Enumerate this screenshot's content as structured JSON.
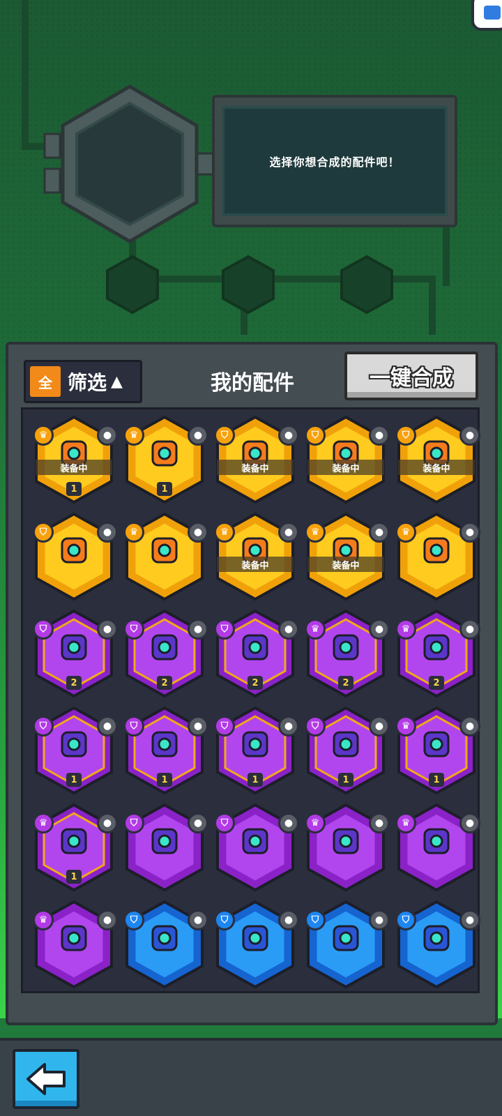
{
  "header": {
    "message": "选择你想合成的配件吧！"
  },
  "panel": {
    "filter_badge": "全",
    "filter_label": "筛选",
    "filter_arrow": "▲",
    "title": "我的配件",
    "merge_button": "一键合成"
  },
  "colors": {
    "gold": "#f7b90c",
    "purple": "#a537e0",
    "blue": "#1d86f0",
    "panel": "#444d52",
    "back_button": "#30b6ec"
  },
  "parts": [
    {
      "tier": "gold",
      "rank": "crown",
      "slot_icon": "device-icon",
      "equipped": "装备中",
      "count": "1",
      "part_icon": "orange-turret-icon"
    },
    {
      "tier": "gold",
      "rank": "crown",
      "slot_icon": "bird-icon",
      "equipped": "",
      "count": "1",
      "part_icon": "orange-drill-icon"
    },
    {
      "tier": "gold",
      "rank": "shield",
      "slot_icon": "rocket-icon",
      "equipped": "装备中",
      "count": "",
      "part_icon": "orange-wings-icon"
    },
    {
      "tier": "gold",
      "rank": "shield",
      "slot_icon": "plant-icon",
      "equipped": "装备中",
      "count": "",
      "part_icon": "orange-block-icon"
    },
    {
      "tier": "gold",
      "rank": "shield",
      "slot_icon": "radar-icon",
      "equipped": "装备中",
      "count": "",
      "part_icon": "orange-armor-icon"
    },
    {
      "tier": "gold",
      "rank": "shield",
      "slot_icon": "arc-icon",
      "equipped": "",
      "count": "",
      "part_icon": "orange-speaker-icon"
    },
    {
      "tier": "gold",
      "rank": "crown",
      "slot_icon": "drill-icon",
      "equipped": "",
      "count": "",
      "part_icon": "orange-cannon-icon"
    },
    {
      "tier": "gold",
      "rank": "crown",
      "slot_icon": "cone-icon",
      "equipped": "装备中",
      "count": "",
      "part_icon": "orange-robot-icon"
    },
    {
      "tier": "gold",
      "rank": "crown",
      "slot_icon": "soccer-icon",
      "equipped": "装备中",
      "count": "",
      "part_icon": "orange-core-icon"
    },
    {
      "tier": "gold",
      "rank": "crown",
      "slot_icon": "device-icon",
      "equipped": "",
      "count": "",
      "part_icon": "orange-gem-icon"
    },
    {
      "tier": "purple",
      "rank": "shield",
      "slot_icon": "rocket-icon",
      "equipped": "",
      "count": "2",
      "part_icon": "purple-wings-icon"
    },
    {
      "tier": "purple",
      "rank": "shield",
      "slot_icon": "brick-icon",
      "equipped": "",
      "count": "2",
      "part_icon": "purple-robot-icon"
    },
    {
      "tier": "purple",
      "rank": "shield",
      "slot_icon": "virus-icon",
      "equipped": "",
      "count": "2",
      "part_icon": "purple-pod-icon"
    },
    {
      "tier": "purple",
      "rank": "crown",
      "slot_icon": "cone-icon",
      "equipped": "",
      "count": "2",
      "part_icon": "purple-battery-icon"
    },
    {
      "tier": "purple",
      "rank": "crown",
      "slot_icon": "bottle-icon",
      "equipped": "",
      "count": "2",
      "part_icon": "purple-triangle-icon"
    },
    {
      "tier": "purple",
      "rank": "shield",
      "slot_icon": "rocket-icon",
      "equipped": "",
      "count": "1",
      "part_icon": "purple-wings-icon"
    },
    {
      "tier": "purple",
      "rank": "shield",
      "slot_icon": "radar-icon",
      "equipped": "",
      "count": "1",
      "part_icon": "purple-arm-icon"
    },
    {
      "tier": "purple",
      "rank": "shield",
      "slot_icon": "brick-icon",
      "equipped": "",
      "count": "1",
      "part_icon": "purple-robot-icon"
    },
    {
      "tier": "purple",
      "rank": "shield",
      "slot_icon": "arc-icon",
      "equipped": "",
      "count": "1",
      "part_icon": "purple-speaker-icon"
    },
    {
      "tier": "purple",
      "rank": "crown",
      "slot_icon": "soccer-icon",
      "equipped": "",
      "count": "1",
      "part_icon": "purple-core-icon"
    },
    {
      "tier": "purple",
      "rank": "crown",
      "slot_icon": "bottle-icon",
      "equipped": "",
      "count": "1",
      "part_icon": "purple-triangle-icon"
    },
    {
      "tier": "purple",
      "rank": "shield",
      "slot_icon": "brick-icon",
      "equipped": "",
      "count": "",
      "part_icon": "purple-robot-icon"
    },
    {
      "tier": "purple",
      "rank": "shield",
      "slot_icon": "virus-icon",
      "equipped": "",
      "count": "",
      "part_icon": "purple-pod-icon"
    },
    {
      "tier": "purple",
      "rank": "crown",
      "slot_icon": "drill-icon",
      "equipped": "",
      "count": "",
      "part_icon": "purple-cannon-icon"
    },
    {
      "tier": "purple",
      "rank": "crown",
      "slot_icon": "cone-icon",
      "equipped": "",
      "count": "",
      "part_icon": "purple-battery-icon"
    },
    {
      "tier": "purple",
      "rank": "crown",
      "slot_icon": "soccer-icon",
      "equipped": "",
      "count": "",
      "part_icon": "purple-core-icon"
    },
    {
      "tier": "blue",
      "rank": "shield",
      "slot_icon": "dust-icon",
      "equipped": "",
      "count": "",
      "part_icon": "blue-cylinder-icon"
    },
    {
      "tier": "blue",
      "rank": "shield",
      "slot_icon": "dust-icon",
      "equipped": "",
      "count": "",
      "part_icon": "blue-cylinder-icon"
    },
    {
      "tier": "blue",
      "rank": "shield",
      "slot_icon": "arc-icon",
      "equipped": "",
      "count": "",
      "part_icon": "blue-cube-icon"
    },
    {
      "tier": "blue",
      "rank": "shield",
      "slot_icon": "saw-icon",
      "equipped": "",
      "count": "",
      "part_icon": "blue-pod-icon"
    }
  ]
}
